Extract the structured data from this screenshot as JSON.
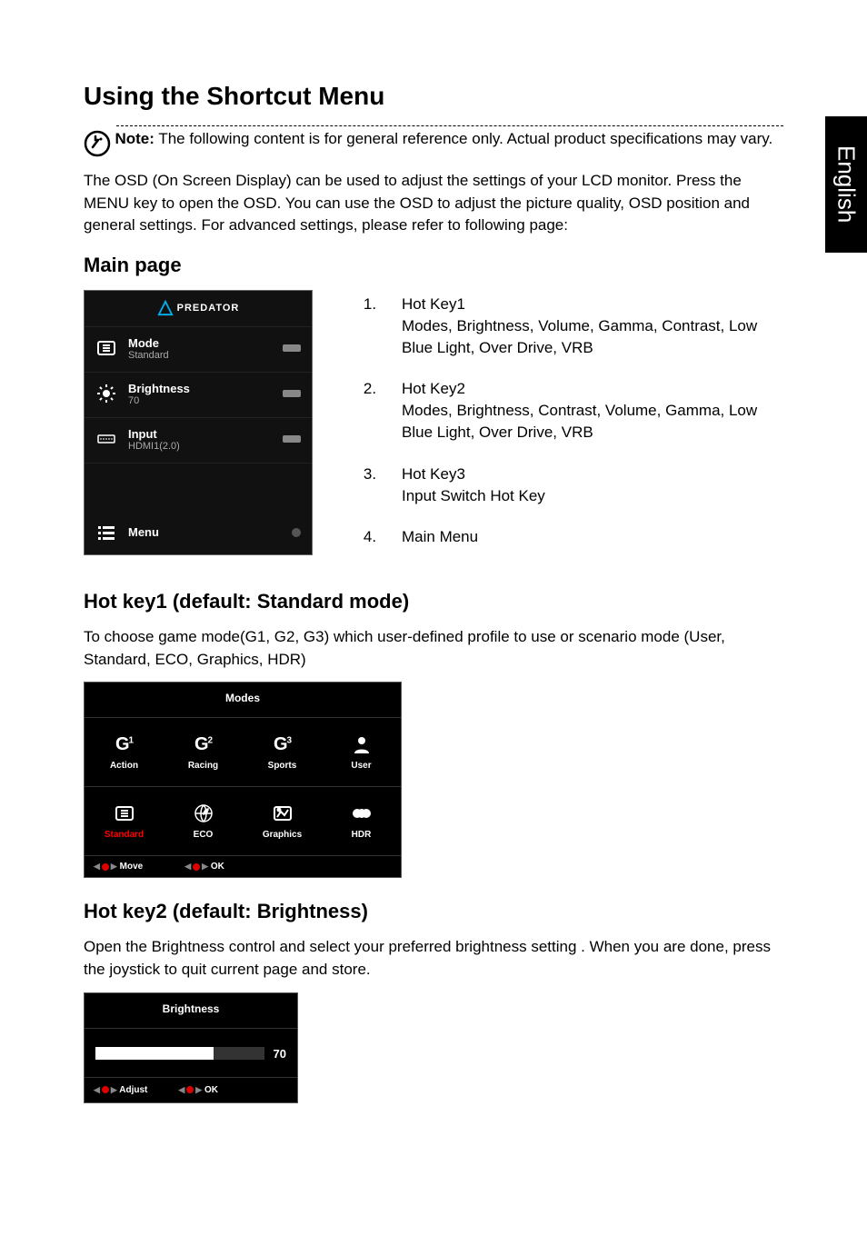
{
  "side_tab": "English",
  "h1": "Using the Shortcut Menu",
  "note_label": "Note:",
  "note_text": " The following content is for general reference only. Actual product specifications may vary.",
  "intro": "The OSD (On Screen Display) can be used to adjust the settings of your LCD monitor. Press the MENU key to open the OSD. You can use the OSD to adjust the picture quality, OSD position and general settings. For advanced settings, please refer to following page:",
  "h2_main": "Main page",
  "osd": {
    "logo": "PREDATOR",
    "items": [
      {
        "title": "Mode",
        "sub": "Standard",
        "icon": "mode-icon",
        "btn": "bar"
      },
      {
        "title": "Brightness",
        "sub": "70",
        "icon": "brightness-icon",
        "btn": "bar"
      },
      {
        "title": "Input",
        "sub": "HDMI1(2.0)",
        "icon": "input-icon",
        "btn": "bar"
      }
    ],
    "menu_label": "Menu"
  },
  "hotkeys": [
    {
      "n": "1.",
      "title": "Hot Key1",
      "desc": "Modes, Brightness, Volume, Gamma, Contrast, Low Blue Light, Over Drive, VRB"
    },
    {
      "n": "2.",
      "title": "Hot Key2",
      "desc": "Modes, Brightness, Contrast, Volume, Gamma, Low Blue Light, Over Drive, VRB"
    },
    {
      "n": "3.",
      "title": "Hot Key3",
      "desc": "Input Switch Hot Key"
    },
    {
      "n": "4.",
      "title": "Main Menu",
      "desc": ""
    }
  ],
  "h2_hk1": "Hot key1 (default: Standard mode)",
  "hk1_text": "To choose game mode(G1, G2, G3) which user-defined profile to use or scenario mode (User, Standard, ECO, Graphics, HDR)",
  "modes": {
    "header": "Modes",
    "cells": [
      {
        "label": "Action",
        "icon": "g1-icon"
      },
      {
        "label": "Racing",
        "icon": "g2-icon"
      },
      {
        "label": "Sports",
        "icon": "g3-icon"
      },
      {
        "label": "User",
        "icon": "user-icon"
      },
      {
        "label": "Standard",
        "icon": "mode-icon",
        "active": true
      },
      {
        "label": "ECO",
        "icon": "eco-icon"
      },
      {
        "label": "Graphics",
        "icon": "graphics-icon"
      },
      {
        "label": "HDR",
        "icon": "hdr-icon"
      }
    ],
    "footer_move": "Move",
    "footer_ok": "OK"
  },
  "h2_hk2": "Hot key2 (default: Brightness)",
  "hk2_text": "Open the Brightness control and select your preferred brightness setting . When you are done, press the joystick to quit current page and store.",
  "brightness": {
    "header": "Brightness",
    "value": "70",
    "footer_adjust": "Adjust",
    "footer_ok": "OK"
  },
  "chart_data": {
    "type": "bar",
    "title": "Brightness",
    "categories": [
      "Brightness"
    ],
    "values": [
      70
    ],
    "ylim": [
      0,
      100
    ]
  }
}
